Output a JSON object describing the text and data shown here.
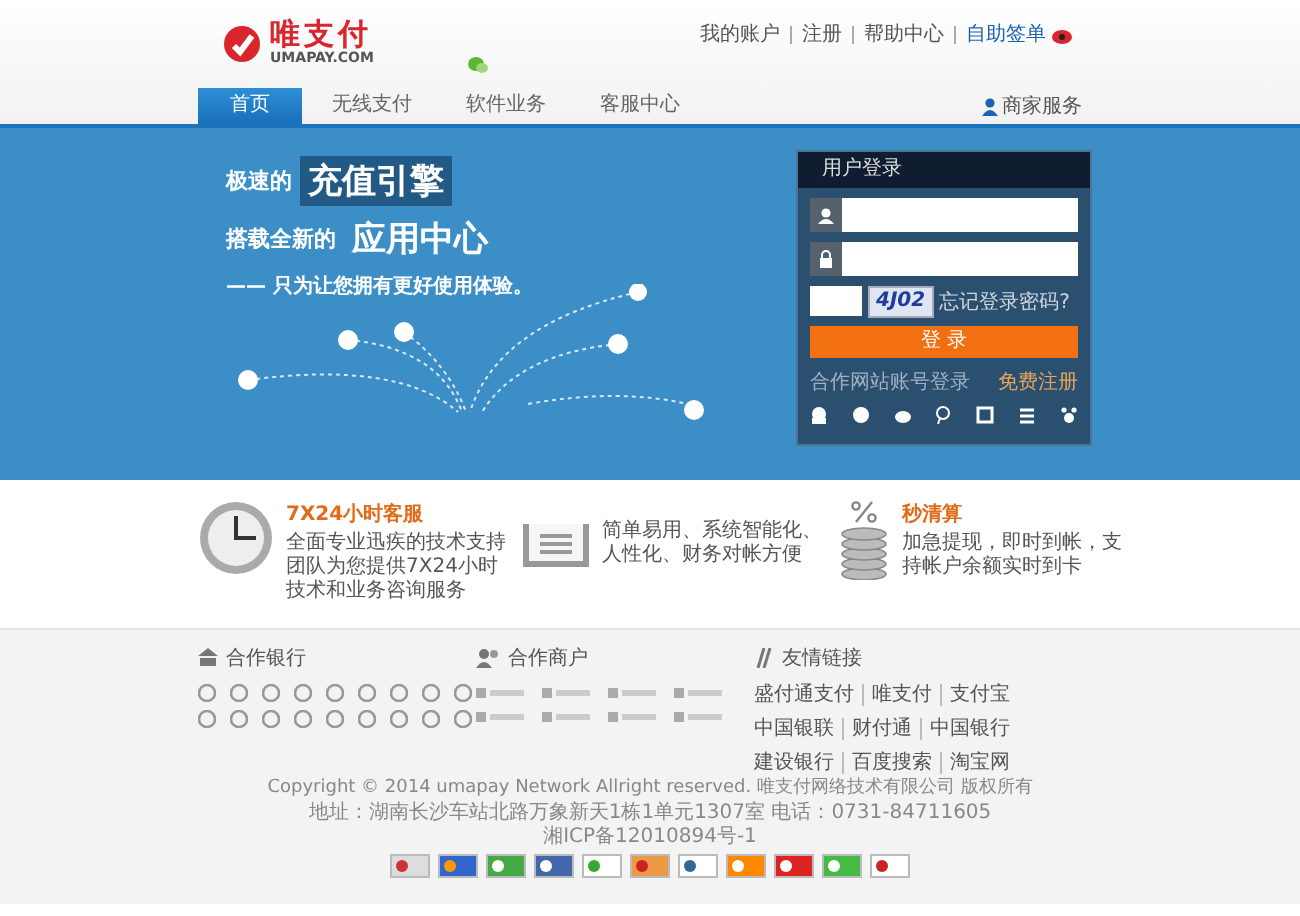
{
  "header": {
    "logo": {
      "name": "唯支付",
      "domain": "UMAPAY.COM"
    },
    "top_links": [
      {
        "label": "我的账户",
        "highlight": false
      },
      {
        "label": "注册",
        "highlight": false
      },
      {
        "label": "帮助中心",
        "highlight": false
      },
      {
        "label": "自助签单",
        "highlight": true
      }
    ]
  },
  "nav": {
    "tabs": [
      {
        "label": "首页",
        "selected": true
      },
      {
        "label": "无线支付",
        "selected": false
      },
      {
        "label": "软件业务",
        "selected": false
      },
      {
        "label": "客服中心",
        "selected": false
      }
    ],
    "merchant_link": "商家服务"
  },
  "banner": {
    "line1_prefix": "极速的",
    "line1_highlight": "充值引擎",
    "line2_prefix": "搭载全新的",
    "line2_highlight": "应用中心",
    "tagline": "—— 只为让您拥有更好使用体验。"
  },
  "login": {
    "title": "用户登录",
    "captcha": "4J02",
    "forgot_link": "忘记登录密码?",
    "submit": "登 录",
    "partner_login": "合作网站账号登录",
    "register": "免费注册"
  },
  "features": [
    {
      "kind": "clock",
      "title": "7X24小时客服",
      "text": "全面专业迅疾的技术支持团队为您提供7X24小时技术和业务咨询服务"
    },
    {
      "kind": "document",
      "text": "简单易用、系统智能化、人性化、财务对帐方便"
    },
    {
      "kind": "coins",
      "title": "秒清算",
      "text": "加急提现，即时到帐，支持帐户余额实时到卡"
    }
  ],
  "partners": {
    "banks_title": "合作银行",
    "merchants_title": "合作商户",
    "links_title": "友情链接",
    "links": [
      "盛付通支付",
      "唯支付",
      "支付宝",
      "中国银联",
      "财付通",
      "中国银行",
      "建设银行",
      "百度搜索",
      "淘宝网"
    ]
  },
  "footer": {
    "copyright": "Copyright © 2014 umapay Network Allright reserved. 唯支付网络技术有限公司 版权所有",
    "address": "地址：湖南长沙车站北路万象新天1栋1单元1307室  电话：0731-84711605",
    "icp": "湘ICP备12010894号-1"
  }
}
